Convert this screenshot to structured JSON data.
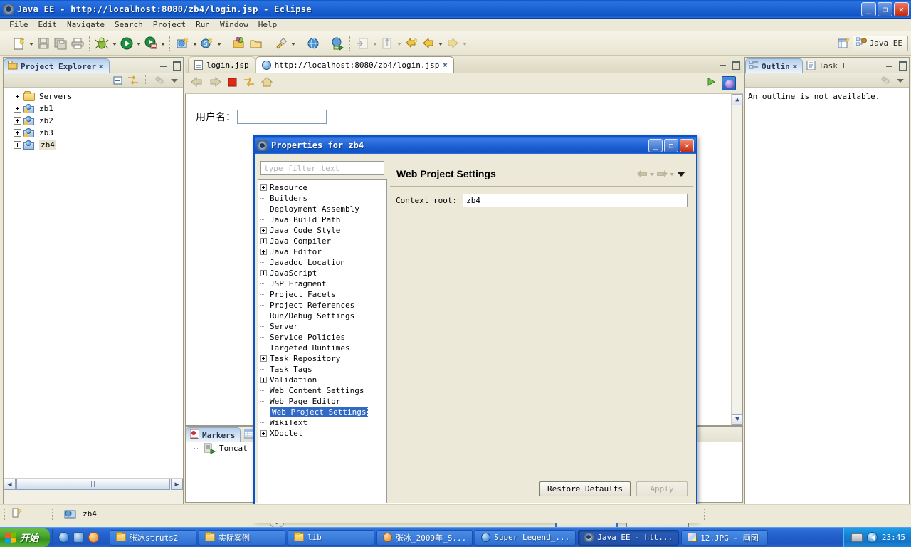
{
  "window": {
    "title": "Java EE - http://localhost:8080/zb4/login.jsp - Eclipse",
    "app_icon": "eclipse-icon",
    "minimize": "_",
    "restore": "□",
    "close": "✕"
  },
  "menubar": {
    "items": [
      "File",
      "Edit",
      "Navigate",
      "Search",
      "Project",
      "Run",
      "Window",
      "Help"
    ]
  },
  "toolbar": {
    "perspective_label": "Java EE",
    "icons": [
      "new-wizard-icon",
      "save-icon",
      "save-all-icon",
      "print-icon",
      "debug-icon",
      "run-icon",
      "run-server-icon",
      "new-web-project-icon",
      "new-js-icon",
      "open-type-icon",
      "open-resource-icon",
      "external-tools-icon",
      "globe-icon",
      "run-on-server-icon",
      "import-icon",
      "export-icon",
      "last-edit-icon",
      "back-icon",
      "forward-icon"
    ]
  },
  "project_explorer": {
    "tab_label": "Project Explorer",
    "tab_icon": "project-explorer-icon",
    "close_icon": "close-icon",
    "toolbar_icons": [
      "collapse-all-icon",
      "link-with-editor-icon",
      "view-menu-icon",
      "view-dropdown-icon"
    ],
    "items": [
      {
        "label": "Servers",
        "icon": "folder-icon",
        "expandable": true,
        "selected": false
      },
      {
        "label": "zb1",
        "icon": "web-project-warning-icon",
        "expandable": true,
        "selected": false
      },
      {
        "label": "zb2",
        "icon": "web-project-warning-icon",
        "expandable": true,
        "selected": false
      },
      {
        "label": "zb3",
        "icon": "web-project-warning-icon",
        "expandable": true,
        "selected": false
      },
      {
        "label": "zb4",
        "icon": "web-project-icon",
        "expandable": true,
        "selected": true
      }
    ]
  },
  "editor": {
    "tabs": [
      {
        "label": "login.jsp",
        "icon": "jsp-file-icon",
        "active": false,
        "closable": false
      },
      {
        "label": "http://localhost:8080/zb4/login.jsp",
        "icon": "globe-icon",
        "active": true,
        "closable": true
      }
    ],
    "browser_toolbar_icons": [
      "back-icon",
      "forward-icon",
      "stop-icon",
      "refresh-icon",
      "home-icon"
    ],
    "page_content": "用户名：",
    "right_icons": [
      "run-icon",
      "browser-icon"
    ]
  },
  "outline": {
    "tabs": [
      {
        "label": "Outlin",
        "icon": "outline-icon",
        "active": true,
        "closable": true
      },
      {
        "label": "Task L",
        "icon": "task-list-icon",
        "active": false,
        "closable": false
      }
    ],
    "toolbar_icons": [
      "view-menu-icon",
      "view-dropdown-icon"
    ],
    "message": "An outline is not available."
  },
  "markers": {
    "tabs": [
      {
        "label": "Markers",
        "icon": "markers-icon",
        "active": true
      },
      {
        "label": "",
        "icon": "properties-icon",
        "active": false
      }
    ],
    "rows": [
      {
        "label": "Tomcat v",
        "icon": "server-icon"
      }
    ]
  },
  "dialog": {
    "title": "Properties for zb4",
    "title_icon": "eclipse-icon",
    "minimize": "_",
    "maximize": "□",
    "close": "✕",
    "filter": {
      "placeholder": "type filter text",
      "value": ""
    },
    "tree": [
      {
        "label": "Resource",
        "expandable": true,
        "selected": false
      },
      {
        "label": "Builders",
        "expandable": false,
        "selected": false
      },
      {
        "label": "Deployment Assembly",
        "expandable": false,
        "selected": false
      },
      {
        "label": "Java Build Path",
        "expandable": false,
        "selected": false
      },
      {
        "label": "Java Code Style",
        "expandable": true,
        "selected": false
      },
      {
        "label": "Java Compiler",
        "expandable": true,
        "selected": false
      },
      {
        "label": "Java Editor",
        "expandable": true,
        "selected": false
      },
      {
        "label": "Javadoc Location",
        "expandable": false,
        "selected": false
      },
      {
        "label": "JavaScript",
        "expandable": true,
        "selected": false
      },
      {
        "label": "JSP Fragment",
        "expandable": false,
        "selected": false
      },
      {
        "label": "Project Facets",
        "expandable": false,
        "selected": false
      },
      {
        "label": "Project References",
        "expandable": false,
        "selected": false
      },
      {
        "label": "Run/Debug Settings",
        "expandable": false,
        "selected": false
      },
      {
        "label": "Server",
        "expandable": false,
        "selected": false
      },
      {
        "label": "Service Policies",
        "expandable": false,
        "selected": false
      },
      {
        "label": "Targeted Runtimes",
        "expandable": false,
        "selected": false
      },
      {
        "label": "Task Repository",
        "expandable": true,
        "selected": false
      },
      {
        "label": "Task Tags",
        "expandable": false,
        "selected": false
      },
      {
        "label": "Validation",
        "expandable": true,
        "selected": false
      },
      {
        "label": "Web Content Settings",
        "expandable": false,
        "selected": false
      },
      {
        "label": "Web Page Editor",
        "expandable": false,
        "selected": false
      },
      {
        "label": "Web Project Settings",
        "expandable": false,
        "selected": true
      },
      {
        "label": "WikiText",
        "expandable": false,
        "selected": false
      },
      {
        "label": "XDoclet",
        "expandable": true,
        "selected": false
      }
    ],
    "page": {
      "heading": "Web Project Settings",
      "nav_back_icon": "back-arrow-icon",
      "nav_forward_icon": "forward-arrow-icon",
      "nav_menu_icon": "chevron-down-icon",
      "context_root_label": "Context root:",
      "context_root_value": "zb4"
    },
    "buttons": {
      "restore_defaults": "Restore Defaults",
      "apply": "Apply",
      "apply_enabled": false,
      "ok": "OK",
      "cancel": "Cancel",
      "help": "?"
    },
    "selection_color": "#316ac5"
  },
  "statusbar": {
    "icons": [
      "writable-icon",
      "project-icon"
    ],
    "project": "zb4"
  },
  "taskbar": {
    "start_label": "开始",
    "quick_launch": [
      "ie-icon",
      "browser-icon",
      "firefox-icon"
    ],
    "items": [
      {
        "label": "张冰struts2",
        "icon": "folder-icon",
        "active": false
      },
      {
        "label": "实际案例",
        "icon": "folder-icon",
        "active": false
      },
      {
        "label": "lib",
        "icon": "folder-icon",
        "active": false
      },
      {
        "label": "张冰_2009年_S...",
        "icon": "orange-app-icon",
        "active": false
      },
      {
        "label": "Super Legend_...",
        "icon": "ie-icon",
        "active": false
      },
      {
        "label": "Java EE - htt...",
        "icon": "eclipse-icon",
        "active": true
      },
      {
        "label": "12.JPG - 画图",
        "icon": "paint-icon",
        "active": false
      }
    ],
    "tray": {
      "keyboard_icon": "keyboard-icon",
      "volume_icon": "media-icon",
      "clock": "23:45"
    }
  }
}
